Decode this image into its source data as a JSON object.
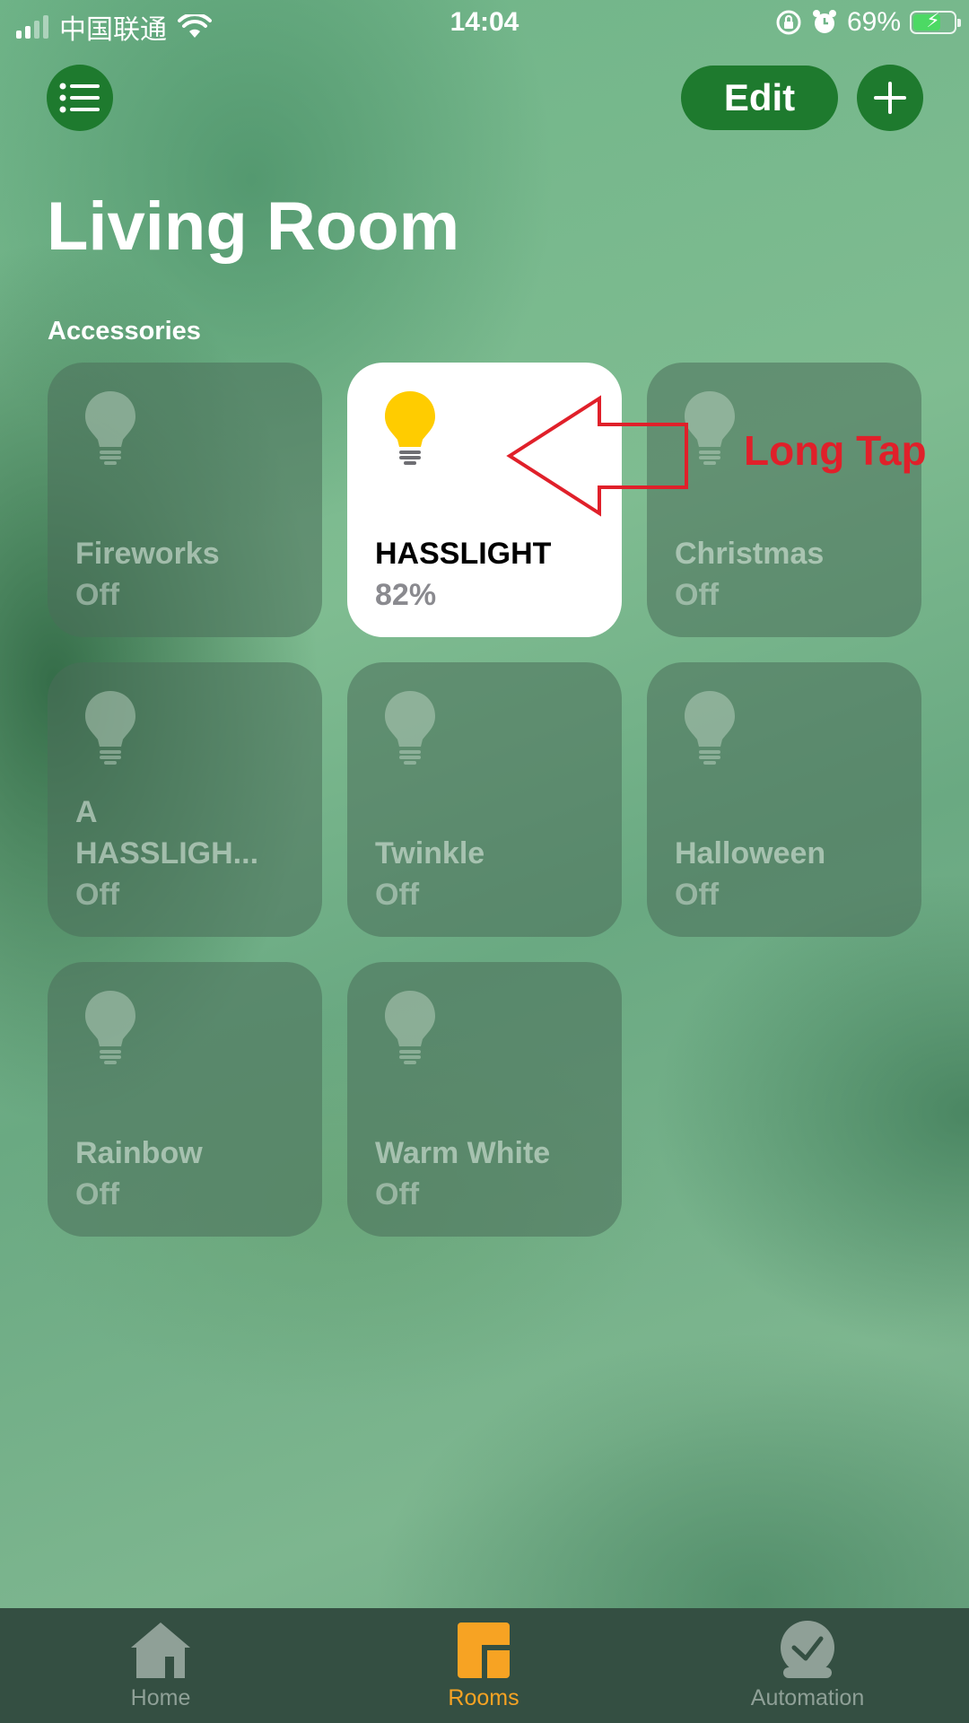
{
  "status_bar": {
    "carrier": "中国联通",
    "time": "14:04",
    "battery_percent": "69%",
    "battery_level": 0.69,
    "icons": [
      "signal-icon",
      "wifi-icon",
      "rotation-lock-icon",
      "alarm-icon",
      "battery-charging-icon"
    ]
  },
  "header": {
    "menu_icon": "list-icon",
    "edit_label": "Edit",
    "add_icon": "plus-icon"
  },
  "page": {
    "title": "Living Room",
    "section_title": "Accessories"
  },
  "tiles": [
    {
      "name": "Fireworks",
      "status": "Off",
      "on": false,
      "icon": "lightbulb-icon"
    },
    {
      "name": "HASSLIGHT",
      "status": "82%",
      "on": true,
      "icon": "lightbulb-icon"
    },
    {
      "name": "Christmas",
      "status": "Off",
      "on": false,
      "icon": "lightbulb-icon"
    },
    {
      "name": "A HASSLIGH...",
      "status": "Off",
      "on": false,
      "icon": "lightbulb-icon"
    },
    {
      "name": "Twinkle",
      "status": "Off",
      "on": false,
      "icon": "lightbulb-icon"
    },
    {
      "name": "Halloween",
      "status": "Off",
      "on": false,
      "icon": "lightbulb-icon"
    },
    {
      "name": "Rainbow",
      "status": "Off",
      "on": false,
      "icon": "lightbulb-icon"
    },
    {
      "name": "Warm White",
      "status": "Off",
      "on": false,
      "icon": "lightbulb-icon"
    }
  ],
  "annotation": {
    "text": "Long Tap",
    "color": "#e0202a"
  },
  "tabbar": {
    "tabs": [
      {
        "label": "Home",
        "icon": "house-icon",
        "active": false
      },
      {
        "label": "Rooms",
        "icon": "rooms-icon",
        "active": true
      },
      {
        "label": "Automation",
        "icon": "automation-icon",
        "active": false
      }
    ]
  },
  "colors": {
    "accent_button": "#1e7a2e",
    "active_tab": "#f7a323",
    "bulb_on": "#ffcc00"
  }
}
